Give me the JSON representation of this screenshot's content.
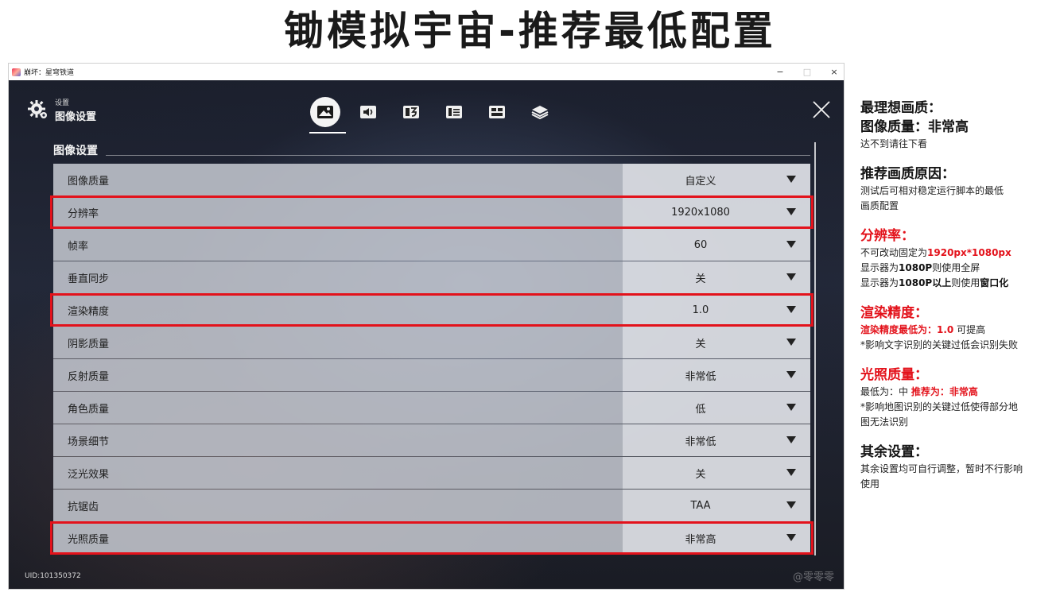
{
  "page_title": "锄模拟宇宙-推荐最低配置",
  "window": {
    "title": "崩坏：星穹铁道",
    "controls": [
      "−",
      "□",
      "×"
    ],
    "settings_small": "设置",
    "settings_big": "图像设置",
    "tabs": [
      "graphics",
      "audio",
      "language",
      "subtitles",
      "controls",
      "resources"
    ],
    "section_title": "图像设置",
    "uid": "UID:101350372",
    "watermark": "@零零零",
    "highlight_color": "#e3121b"
  },
  "rows": [
    {
      "label": "图像质量",
      "value": "自定义",
      "highlighted": false
    },
    {
      "label": "分辨率",
      "value": "1920x1080",
      "highlighted": true
    },
    {
      "label": "帧率",
      "value": "60",
      "highlighted": false
    },
    {
      "label": "垂直同步",
      "value": "关",
      "highlighted": false
    },
    {
      "label": "渲染精度",
      "value": "1.0",
      "highlighted": true
    },
    {
      "label": "阴影质量",
      "value": "关",
      "highlighted": false
    },
    {
      "label": "反射质量",
      "value": "非常低",
      "highlighted": false
    },
    {
      "label": "角色质量",
      "value": "低",
      "highlighted": false
    },
    {
      "label": "场景细节",
      "value": "非常低",
      "highlighted": false
    },
    {
      "label": "泛光效果",
      "value": "关",
      "highlighted": false
    },
    {
      "label": "抗锯齿",
      "value": "TAA",
      "highlighted": false
    },
    {
      "label": "光照质量",
      "value": "非常高",
      "highlighted": true
    }
  ],
  "notes": {
    "ideal": {
      "heading": "最理想画质：",
      "subheading": "图像质量：非常高",
      "line": "达不到请往下看"
    },
    "reason": {
      "heading": "推荐画质原因：",
      "line1": "测试后可相对稳定运行脚本的最低",
      "line2": "画质配置"
    },
    "resolution": {
      "heading": "分辨率：",
      "l1_a": "不可改动固定为",
      "l1_b": "1920px*1080px",
      "l2_a": "显示器为",
      "l2_b": "1080P",
      "l2_c": "则使用全屏",
      "l3_a": "显示器为",
      "l3_b": "1080P以上",
      "l3_c": "则使用",
      "l3_d": "窗口化"
    },
    "render": {
      "heading": "渲染精度：",
      "l1_a": "渲染精度最低为：",
      "l1_b": "1.0",
      "l1_c": " 可提高",
      "l2": "*影响文字识别的关键过低会识别失败"
    },
    "lighting": {
      "heading": "光照质量：",
      "l1_a": "最低为：中  ",
      "l1_b": "推荐为：非常高",
      "l2": "*影响地图识别的关键过低使得部分地",
      "l3": "图无法识别"
    },
    "other": {
      "heading": "其余设置：",
      "line1": "其余设置均可自行调整，暂时不行影响",
      "line2": "使用"
    }
  }
}
